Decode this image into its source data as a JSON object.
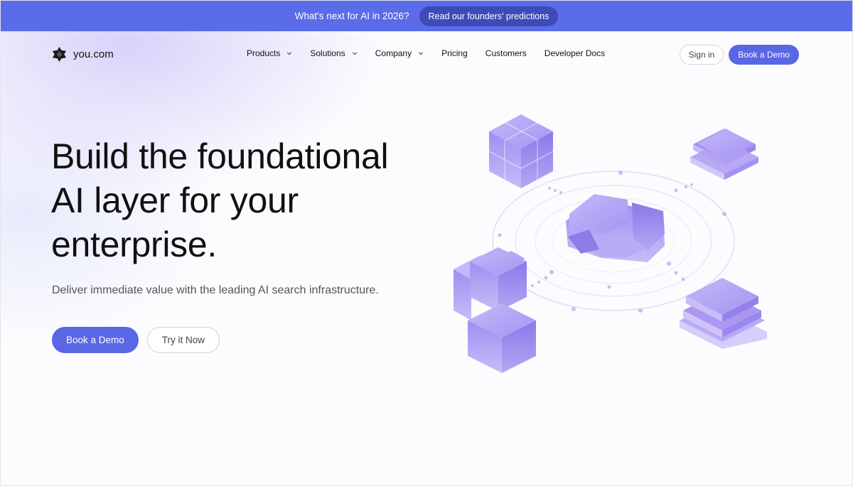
{
  "announcement": {
    "text": "What's next for AI in 2026?",
    "cta": "Read our founders' predictions"
  },
  "nav": {
    "logo_text": "you.com",
    "items": [
      {
        "label": "Products",
        "has_dropdown": true
      },
      {
        "label": "Solutions",
        "has_dropdown": true
      },
      {
        "label": "Company",
        "has_dropdown": true
      },
      {
        "label": "Pricing",
        "has_dropdown": false
      },
      {
        "label": "Customers",
        "has_dropdown": false
      },
      {
        "label": "Developer Docs",
        "has_dropdown": false
      }
    ],
    "signin": "Sign in",
    "demo": "Book a Demo"
  },
  "hero": {
    "title_lines": [
      "Build the foundational",
      "AI layer for your",
      "enterprise."
    ],
    "subtitle": "Deliver immediate value with the leading AI search infrastructure.",
    "primary_cta": "Book a Demo",
    "secondary_cta": "Try it Now"
  },
  "colors": {
    "brand": "#5966e6",
    "announce_bg": "#5a6ce8",
    "announce_btn": "#3d4bb8",
    "illustration_purple": "#9b88ee"
  },
  "icons": {
    "logo": "you-logo-icon",
    "dropdown": "chevron-down-icon"
  }
}
